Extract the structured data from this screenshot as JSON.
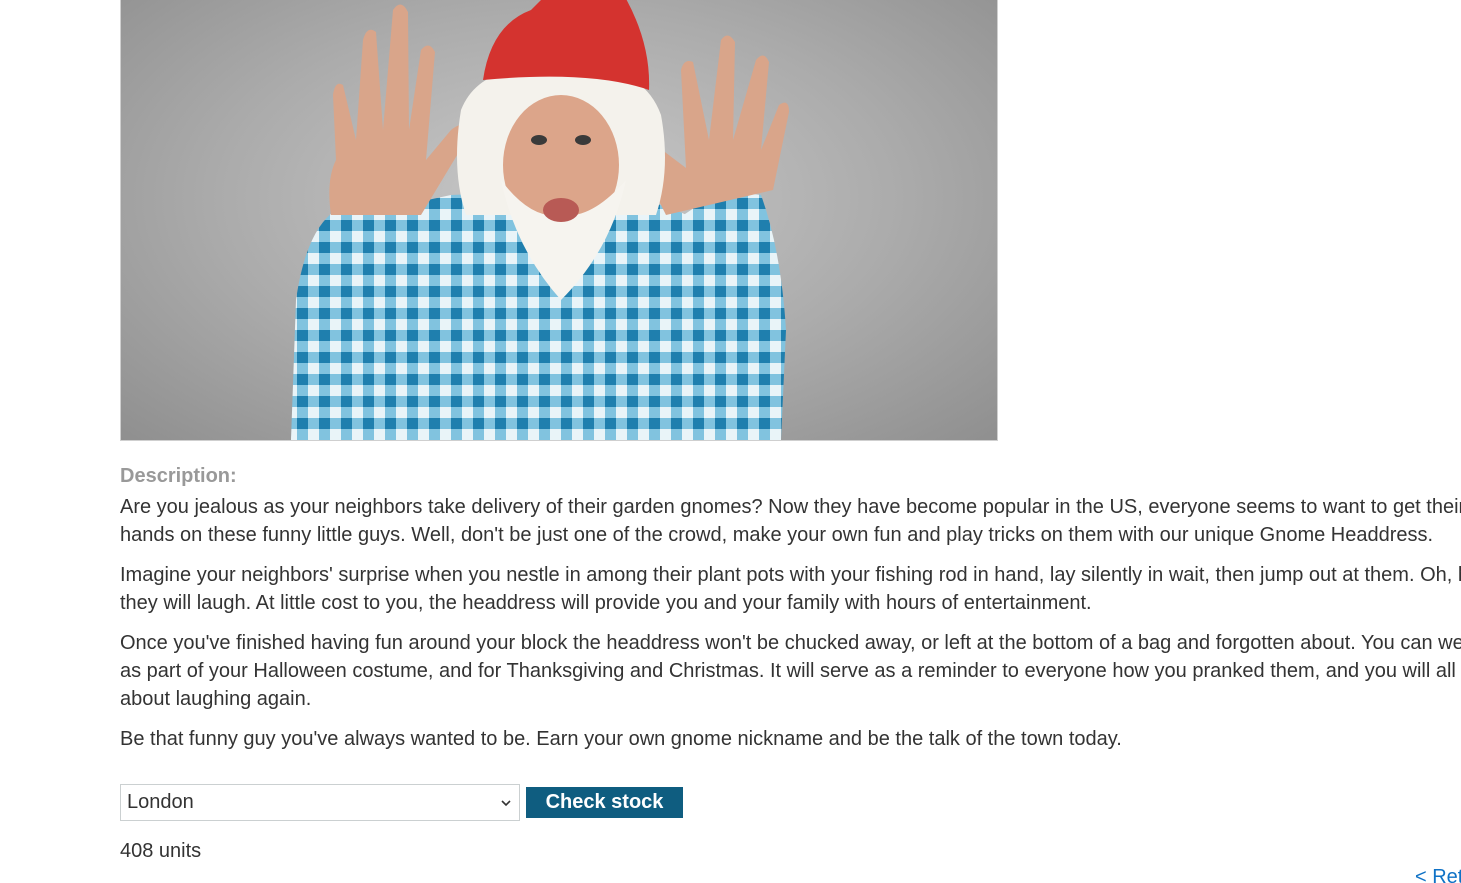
{
  "product": {
    "image_alt": "Man wearing red gnome hat and white beard in blue gingham shirt"
  },
  "description": {
    "label": "Description:",
    "paragraphs": [
      "Are you jealous as your neighbors take delivery of their garden gnomes? Now they have become popular in the US, everyone seems to want to get their hands on these funny little guys. Well, don't be just one of the crowd, make your own fun and play tricks on them with our unique Gnome Headdress.",
      "Imagine your neighbors' surprise when you nestle in among their plant pots with your fishing rod in hand, lay silently in wait, then jump out at them. Oh, how they will laugh. At little cost to you, the headdress will provide you and your family with hours of entertainment.",
      "Once you've finished having fun around your block the headdress won't be chucked away, or left at the bottom of a bag and forgotten about. You can wear it as part of your Halloween costume, and for Thanksgiving and Christmas. It will serve as a reminder to everyone how you pranked them, and you will all fall about laughing again.",
      "Be that funny guy you've always wanted to be. Earn your own gnome nickname and be the talk of the town today."
    ]
  },
  "stock_check": {
    "selected_store": "London",
    "button_label": "Check stock",
    "result": "408 units"
  },
  "navigation": {
    "return_link": "< Return to list"
  },
  "colors": {
    "button_bg": "#0f5d80",
    "link": "#0f72c6",
    "label_grey": "#999999"
  }
}
